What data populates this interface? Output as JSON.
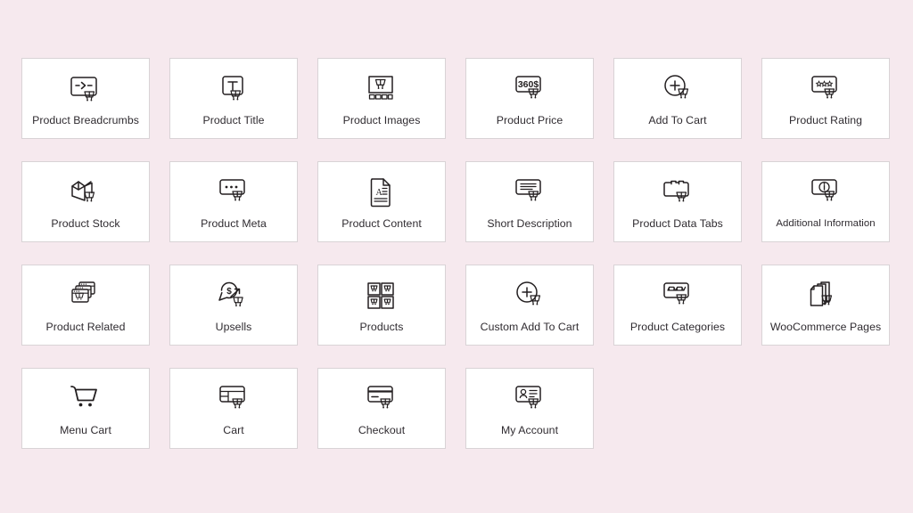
{
  "page": {
    "background_color": "#f6e9ee",
    "card_color": "#ffffff",
    "card_border_color": "#d9d3d6",
    "label_color": "#2f2b30",
    "icon_color": "#231f20",
    "columns": 6,
    "total_widgets": 22
  },
  "widgets": [
    {
      "label": "Product Breadcrumbs",
      "icon": "breadcrumb-cart-icon"
    },
    {
      "label": "Product Title",
      "icon": "title-text-cart-icon"
    },
    {
      "label": "Product Images",
      "icon": "gallery-cart-icon"
    },
    {
      "label": "Product Price",
      "icon": "price-tag-cart-icon",
      "icon_text": "360$"
    },
    {
      "label": "Add To Cart",
      "icon": "plus-circle-cart-icon"
    },
    {
      "label": "Product Rating",
      "icon": "stars-cart-icon"
    },
    {
      "label": "Product Stock",
      "icon": "open-box-cart-icon"
    },
    {
      "label": "Product Meta",
      "icon": "dots-bubble-cart-icon"
    },
    {
      "label": "Product Content",
      "icon": "document-text-icon"
    },
    {
      "label": "Short Description",
      "icon": "lines-bubble-cart-icon"
    },
    {
      "label": "Product Data Tabs",
      "icon": "folder-tabs-cart-icon"
    },
    {
      "label": "Additional Information",
      "icon": "info-bubble-cart-icon"
    },
    {
      "label": "Product Related",
      "icon": "stacked-windows-cart-icon"
    },
    {
      "label": "Upsells",
      "icon": "dollar-arrow-cart-icon"
    },
    {
      "label": "Products",
      "icon": "grid-four-carts-icon"
    },
    {
      "label": "Custom Add To Cart",
      "icon": "plus-circle-cart-icon"
    },
    {
      "label": "Product Categories",
      "icon": "category-boxes-cart-icon"
    },
    {
      "label": "WooCommerce Pages",
      "icon": "pages-stack-cart-icon"
    },
    {
      "label": "Menu Cart",
      "icon": "shopping-cart-icon"
    },
    {
      "label": "Cart",
      "icon": "cart-table-cart-icon"
    },
    {
      "label": "Checkout",
      "icon": "credit-card-cart-icon"
    },
    {
      "label": "My Account",
      "icon": "user-card-cart-icon"
    }
  ]
}
